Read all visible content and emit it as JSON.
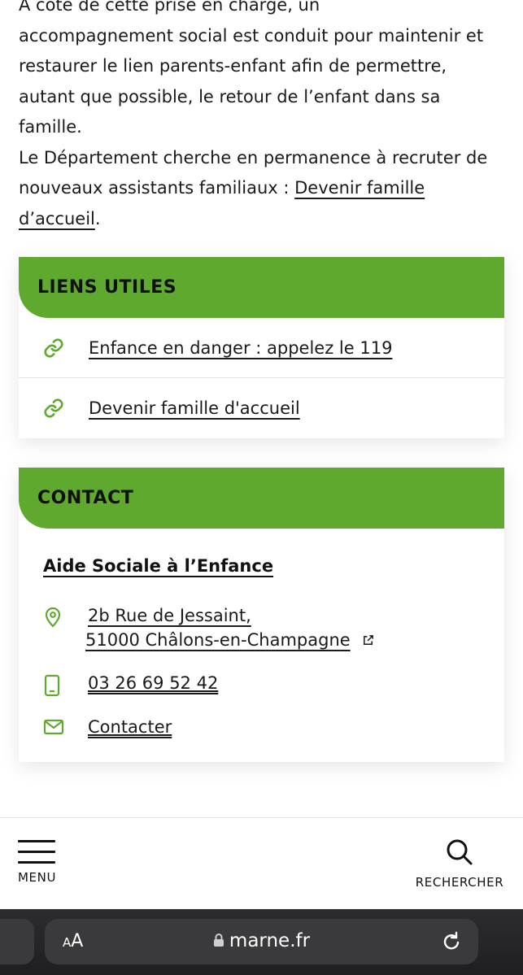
{
  "article": {
    "line1": "A côté de cette prise en charge, un",
    "para1_rest": "accompagnement social est conduit pour maintenir et restaurer le lien parents-enfant afin de permettre, autant que possible, le retour de l’enfant dans sa famille.",
    "para2_text": "Le Département cherche en permanence à recruter de nouveaux assistants familiaux : ",
    "para2_link": "Devenir famille d’accueil",
    "para2_end": "."
  },
  "liens_utiles": {
    "title": "LIENS UTILES",
    "links": [
      {
        "label": "Enfance en danger : appelez le 119",
        "icon": "link-icon"
      },
      {
        "label": "Devenir famille d'accueil",
        "icon": "link-icon"
      }
    ]
  },
  "contact": {
    "title": "CONTACT",
    "organization": "Aide Sociale à l’Enfance",
    "address_line1": "2b Rue de Jessaint,",
    "address_line2": "51000 Châlons-en-Champagne",
    "phone": "03 26 69 52 42",
    "contact_link": "Contacter"
  },
  "bottom_nav": {
    "menu_label": "MENU",
    "search_label": "RECHERCHER"
  },
  "browser": {
    "aa_small": "A",
    "aa_large": "A",
    "domain": "marne.fr"
  },
  "colors": {
    "accent_green": "#5fa92e",
    "icon_green": "#5fa92e"
  }
}
